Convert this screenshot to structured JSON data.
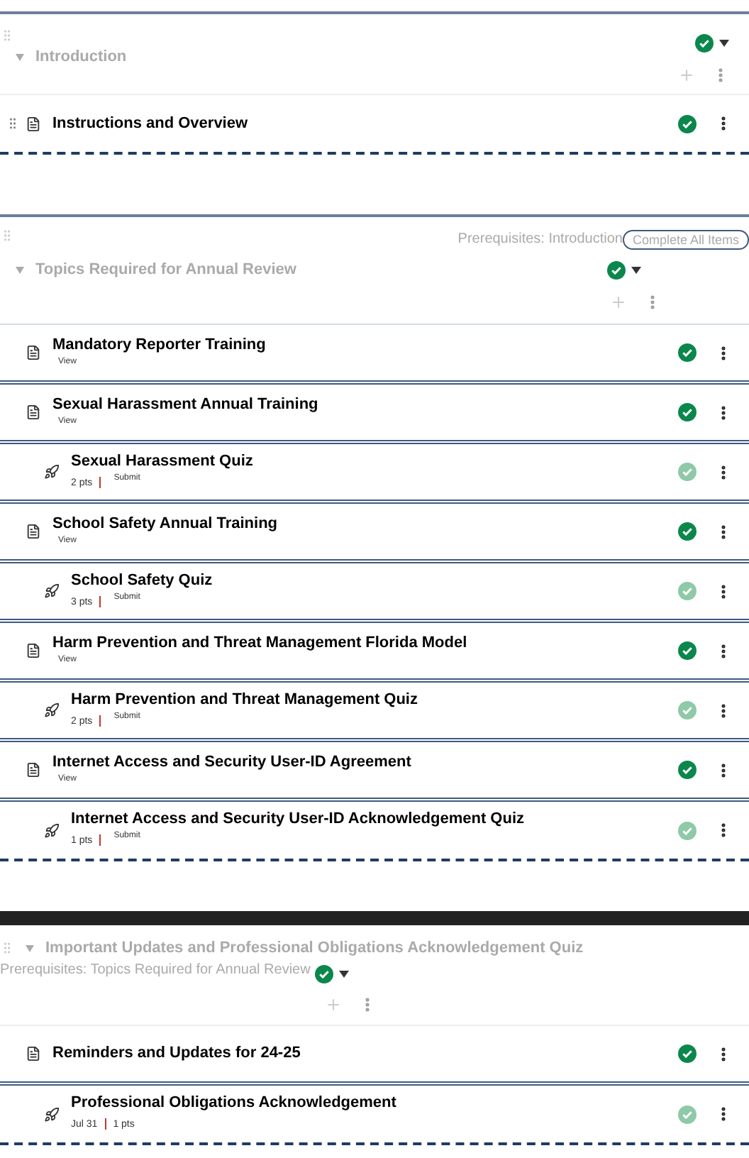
{
  "modules": [
    {
      "title": "Introduction",
      "expanded": true,
      "focused": false,
      "published": true,
      "items": [
        {
          "kind": "page",
          "title": "Instructions and Overview",
          "indented": false,
          "draggable": true,
          "faded": false
        }
      ]
    },
    {
      "title": "Topics Required for Annual Review",
      "expanded": true,
      "focused": false,
      "published": true,
      "prerequisites": "Prerequisites: Introduction",
      "requirement": "Complete All Items",
      "items": [
        {
          "kind": "page",
          "title": "Mandatory Reporter Training",
          "indented": false,
          "draggable": false,
          "faded": false,
          "action": "View"
        },
        {
          "kind": "page",
          "title": "Sexual Harassment Annual Training",
          "indented": false,
          "draggable": false,
          "faded": false,
          "action": "View"
        },
        {
          "kind": "quiz",
          "title": "Sexual Harassment Quiz",
          "indented": true,
          "draggable": false,
          "faded": true,
          "details": [
            "2 pts"
          ],
          "action": "Submit"
        },
        {
          "kind": "page",
          "title": "School Safety Annual Training",
          "indented": false,
          "draggable": false,
          "faded": false,
          "action": "View"
        },
        {
          "kind": "quiz",
          "title": "School Safety Quiz",
          "indented": true,
          "draggable": false,
          "faded": true,
          "details": [
            "3 pts"
          ],
          "action": "Submit"
        },
        {
          "kind": "page",
          "title": "Harm Prevention and Threat Management Florida Model",
          "indented": false,
          "draggable": false,
          "faded": false,
          "action": "View"
        },
        {
          "kind": "quiz",
          "title": "Harm Prevention and Threat Management Quiz",
          "indented": true,
          "draggable": false,
          "faded": true,
          "details": [
            "2 pts"
          ],
          "action": "Submit"
        },
        {
          "kind": "page",
          "title": "Internet Access and Security User-ID Agreement",
          "indented": false,
          "draggable": false,
          "faded": false,
          "action": "View"
        },
        {
          "kind": "quiz",
          "title": "Internet Access and Security User-ID Acknowledgement Quiz",
          "indented": true,
          "draggable": false,
          "faded": true,
          "details": [
            "1 pts"
          ],
          "action": "Submit"
        }
      ]
    },
    {
      "title": "Important Updates and Professional Obligations Acknowledgement Quiz",
      "expanded": true,
      "focused": true,
      "published": true,
      "prerequisites": "Prerequisites: Topics Required for Annual Review",
      "items": [
        {
          "kind": "page",
          "title": "Reminders and Updates for 24-25",
          "indented": false,
          "draggable": false,
          "faded": false
        },
        {
          "kind": "quiz",
          "title": "Professional Obligations Acknowledgement",
          "indented": true,
          "draggable": false,
          "faded": true,
          "details": [
            "Jul 31",
            "1 pts"
          ]
        }
      ]
    }
  ]
}
